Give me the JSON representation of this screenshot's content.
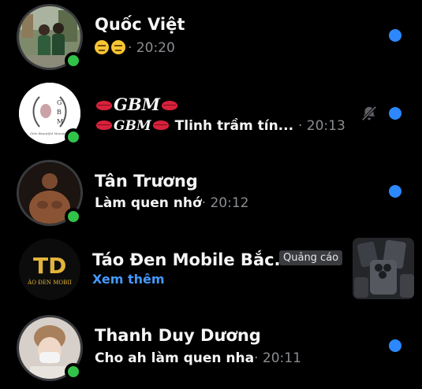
{
  "conversations": [
    {
      "name": "Quốc Việt",
      "preview": "",
      "time": "· 20:20",
      "unread": true,
      "online": true,
      "avatar_icon": "photo-avatar-icon"
    },
    {
      "name": "GBM",
      "preview_sender": "GBM",
      "preview": "Tlinh trầm tín...",
      "time": "· 20:13",
      "unread": true,
      "online": true,
      "muted": true,
      "avatar_icon": "gbm-logo-icon",
      "avatar_tagline": "Girls Beautiful Mommies"
    },
    {
      "name": "Tân Trương",
      "preview": "Làm quen nhớ",
      "time": "· 20:12",
      "unread": true,
      "online": true,
      "avatar_icon": "photo-avatar-icon"
    },
    {
      "name": "Táo Đen Mobile Bắc...",
      "badge": "Quảng cáo",
      "see_more": "Xem thêm",
      "sponsored": true,
      "avatar_icon": "tao-den-logo-icon",
      "avatar_caption": "ÁO ĐEN MOBII"
    },
    {
      "name": "Thanh Duy Dương",
      "preview": "Cho ah làm quen nha",
      "time": "· 20:11",
      "unread": true,
      "online": true,
      "avatar_icon": "photo-avatar-icon"
    }
  ],
  "colors": {
    "background": "#000000",
    "online": "#31c24a",
    "unread": "#2d88ff",
    "link": "#4599ff",
    "muted_text": "#8a8d91"
  }
}
